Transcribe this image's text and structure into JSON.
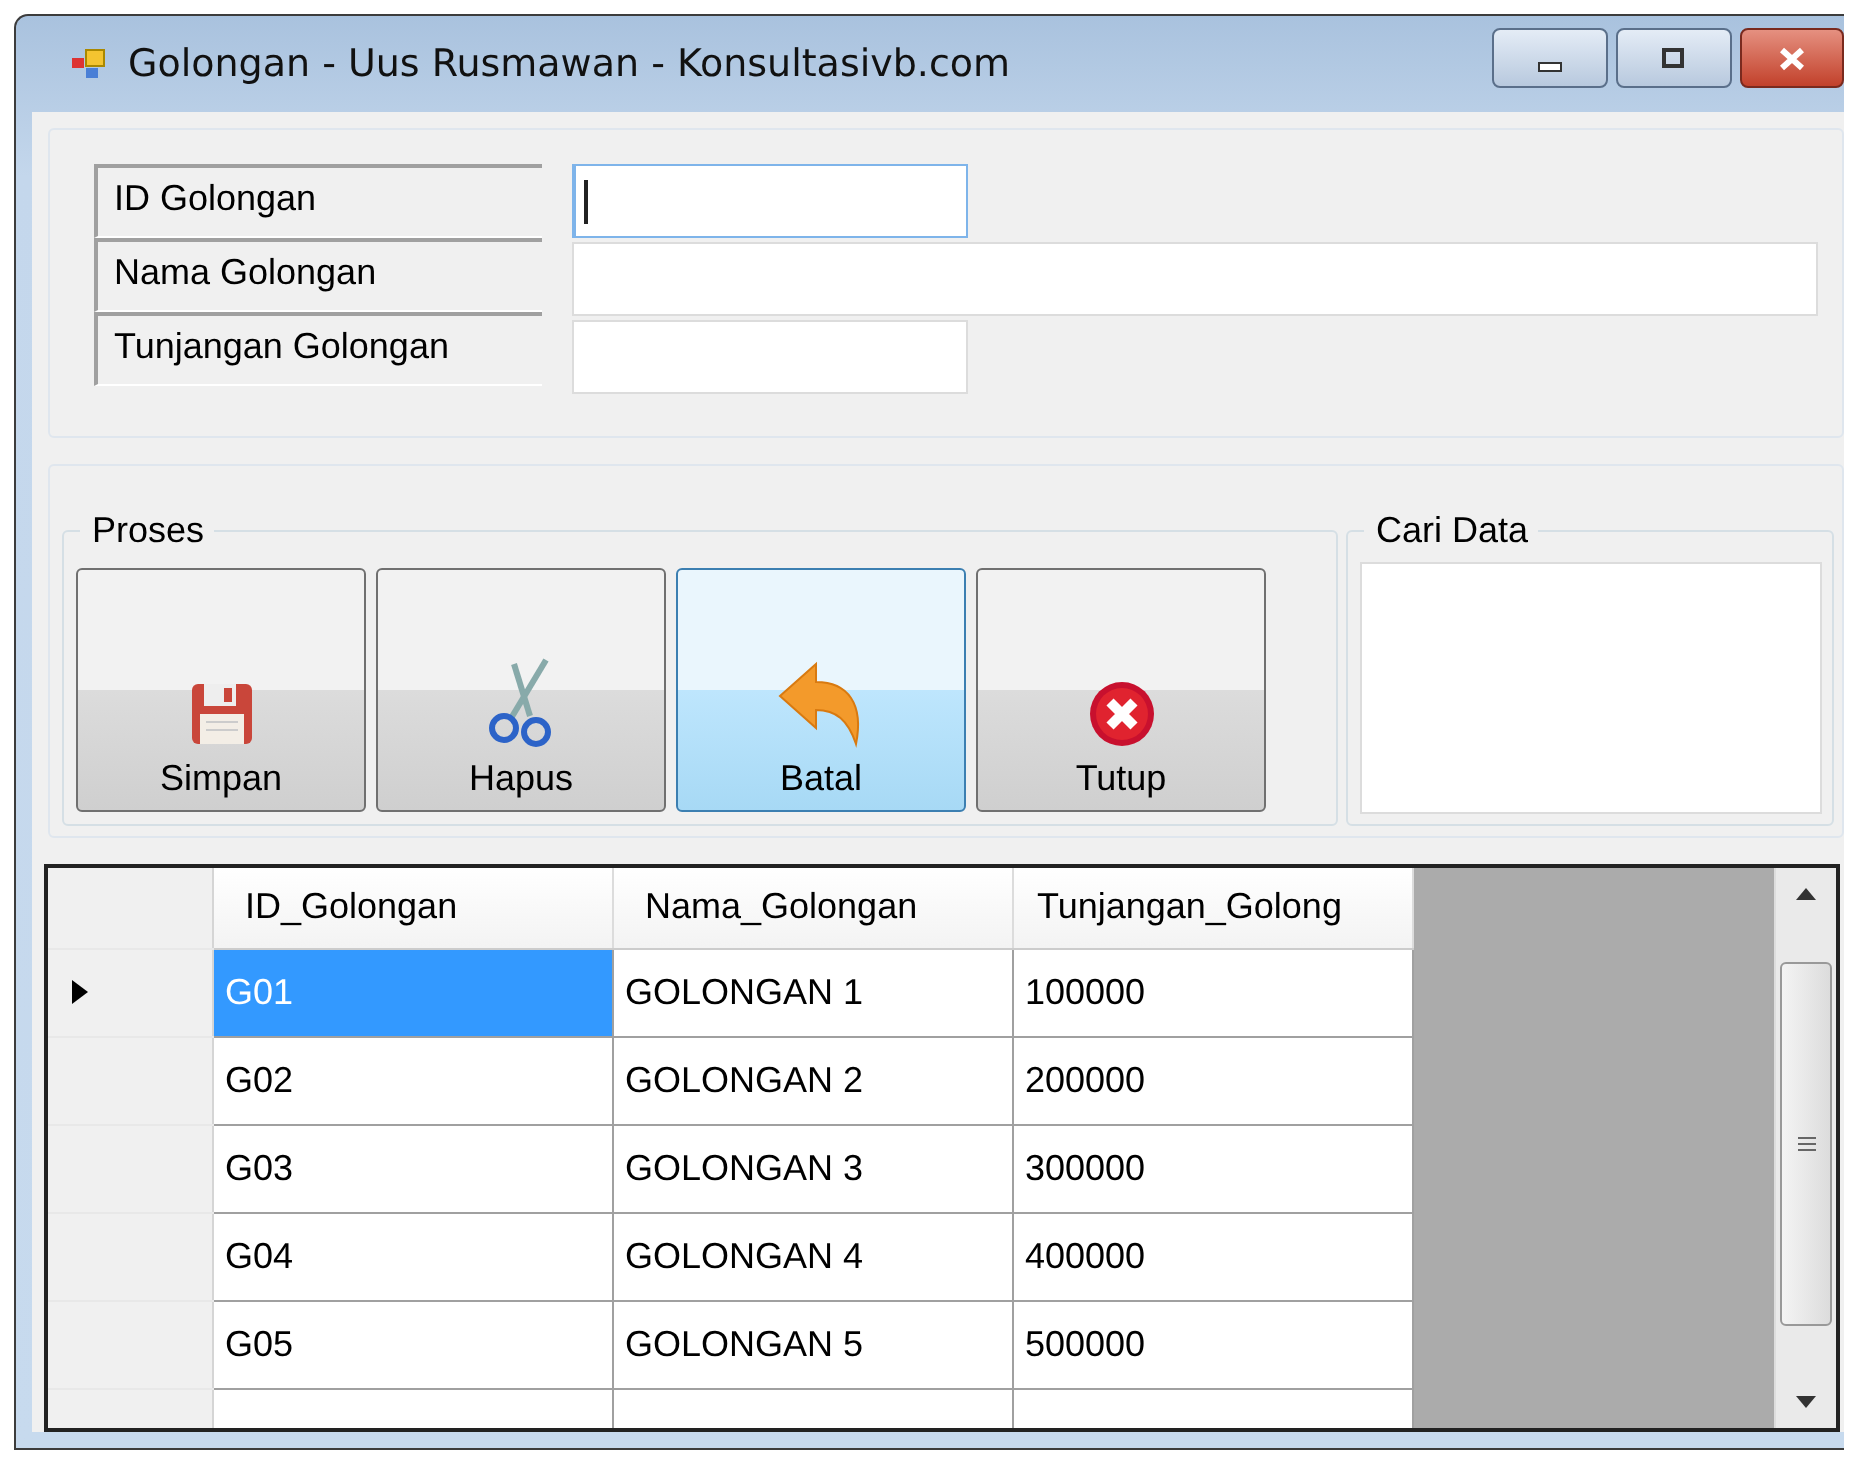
{
  "window": {
    "title": "Golongan  - Uus Rusmawan - Konsultasivb.com"
  },
  "form": {
    "fields": [
      {
        "label": "ID Golongan",
        "focused": true
      },
      {
        "label": "Nama Golongan",
        "focused": false
      },
      {
        "label": "Tunjangan Golongan",
        "focused": false
      }
    ]
  },
  "proses": {
    "title": "Proses",
    "buttons": [
      {
        "label": "Simpan",
        "kind": "save",
        "hovered": false
      },
      {
        "label": "Hapus",
        "kind": "cut",
        "hovered": false
      },
      {
        "label": "Batal",
        "kind": "undo",
        "hovered": true
      },
      {
        "label": "Tutup",
        "kind": "close",
        "hovered": false
      }
    ]
  },
  "search": {
    "title": "Cari Data"
  },
  "table": {
    "columns": [
      "ID_Golongan",
      "Nama_Golongan",
      "Tunjangan_Golong"
    ],
    "rows": [
      {
        "cells": [
          "G01",
          "GOLONGAN 1",
          "100000"
        ],
        "selected": true
      },
      {
        "cells": [
          "G02",
          "GOLONGAN 2",
          "200000"
        ],
        "selected": false
      },
      {
        "cells": [
          "G03",
          "GOLONGAN 3",
          "300000"
        ],
        "selected": false
      },
      {
        "cells": [
          "G04",
          "GOLONGAN 4",
          "400000"
        ],
        "selected": false
      },
      {
        "cells": [
          "G05",
          "GOLONGAN 5",
          "500000"
        ],
        "selected": false
      }
    ]
  }
}
